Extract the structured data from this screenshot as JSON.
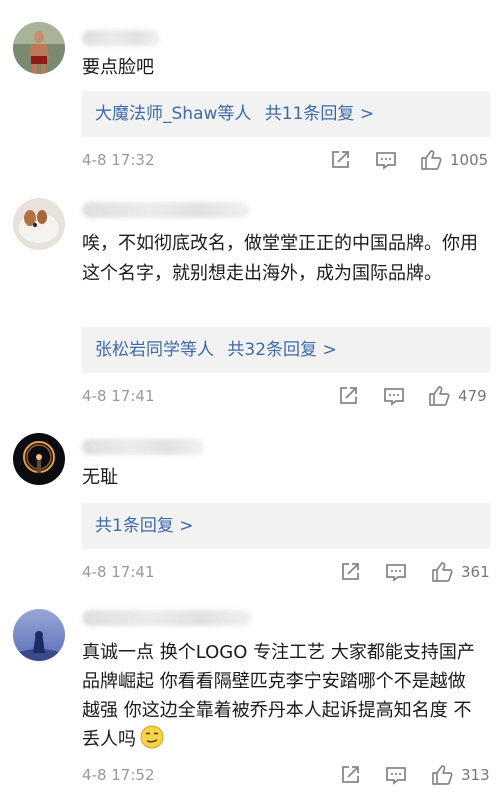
{
  "comments": [
    {
      "text": "要点脸吧",
      "reply": {
        "users": "大魔法师_Shaw",
        "suffix": "等人",
        "count": "共11条回复 >"
      },
      "time": "4-8 17:32",
      "likes": "1005"
    },
    {
      "text": "唉，不如彻底改名，做堂堂正正的中国品牌。你用这个名字，就别想走出海外，成为国际品牌。",
      "reply": {
        "users": "张松岩同学",
        "suffix": "等人",
        "count": "共32条回复 >"
      },
      "time": "4-8 17:41",
      "likes": "479"
    },
    {
      "text": "无耻",
      "reply": {
        "users": "",
        "suffix": "",
        "count": "共1条回复 >"
      },
      "time": "4-8 17:41",
      "likes": "361"
    },
    {
      "text": "真诚一点 换个LOGO 专注工艺 大家都能支持国产品牌崛起 你看看隔壁匹克李宁安踏哪个不是越做越强 你这边全靠着被乔丹本人起诉提高知名度 不丢人吗",
      "emoji": "smirk-emoji",
      "time": "4-8 17:52",
      "likes": "313"
    }
  ],
  "icons": {
    "share": "share-icon",
    "comment": "comment-icon",
    "like": "thumbs-up-icon"
  },
  "colors": {
    "link": "#3d6aa8",
    "reply_bg": "#f2f2f2",
    "meta": "#9a9a9a"
  }
}
